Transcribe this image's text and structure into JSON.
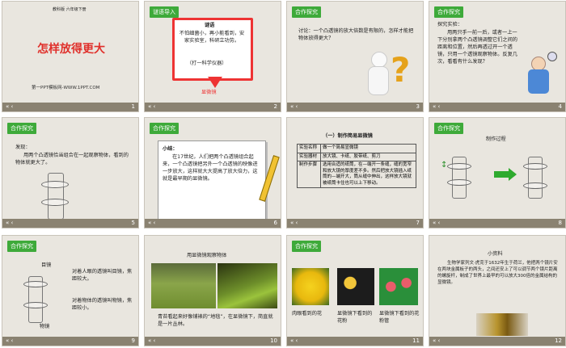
{
  "footer": {
    "nav_glyph": "«  ‹"
  },
  "slides": {
    "s1": {
      "publisher": "教科版   六年级下册",
      "title": "怎样放得更大",
      "site": "第一PPT模板网-WWW.1PPT.COM",
      "num": "1"
    },
    "s2": {
      "tag": "谜语导入",
      "riddle_title": "谜语",
      "riddle": "不怕细菌小，再小能看到，安家实验室，科研立功劳。",
      "hint": "（打一科学仪器）",
      "answer": "显微镜",
      "num": "2"
    },
    "s3": {
      "tag": "合作探究",
      "text": "讨论：一个凸透镜的放大倍数是有限的，怎样才能把物体放得更大？",
      "num": "3"
    },
    "s4": {
      "tag": "合作探究",
      "heading": "探究实验：",
      "text": "用两只手一前一后，或者一上一下分别拿两个凸透镜调整它们之间的距离和位置，然后再透过开一个透镜，只用一个透镜观察物体。反复几次，看看有什么发现？",
      "num": "4"
    },
    "s5": {
      "tag": "合作探究",
      "heading": "发现：",
      "text": "用两个凸透镜恰当组合在一起观察物体，看到的物体就更大了。",
      "num": "5"
    },
    "s6": {
      "tag": "合作探究",
      "heading": "小结：",
      "text": "在17世纪，人们把两个凸透镜组合起来，一个凸透镜把另外一个凸透镜的映像进一步放大，这样就大大提高了放大倍力，这就是最早期的显微镜。",
      "num": "6"
    },
    "s7": {
      "title": "（一）制作简易显微镜",
      "rows": [
        {
          "label": "实验名称",
          "value": "做一个简易显微镜"
        },
        {
          "label": "实验器材",
          "value": "放大镜、卡纸、胶带纸、剪刀"
        },
        {
          "label": "制作步骤",
          "value": "选用合适的纸筒，在—端开一条缝，缝的宽窄和放大镜的厚度差不多。然后把放大镜插入纸筒的—端开大，筒从缝中伸出，这样放大镜就被纸筒卡住也可以上下移动。"
        }
      ],
      "num": "7"
    },
    "s8": {
      "tag": "合作探究",
      "heading": "制作过程",
      "num": "8"
    },
    "s9": {
      "tag": "合作探究",
      "eyepiece": "目镜",
      "objective": "物镜",
      "text1": "对着人眼的透镜叫目镜，焦距较大。",
      "text2": "对着物体的透镜叫物镜，焦距较小。",
      "num": "9"
    },
    "s10": {
      "title": "用显微镜观察物体",
      "caption": "青苔看起来好像铺裱的“地毯”，在显微镜下，简直就是一片丛林。",
      "num": "10"
    },
    "s11": {
      "tag": "合作探究",
      "cap1": "肉眼看到的花",
      "cap2": "显微镜下看到的花粉",
      "cap3": "显微镜下看到的花粉管",
      "num": "11"
    },
    "s12": {
      "title": "小资料",
      "text": "生物学家列文·虎克于1632年生于荷兰，他把两个镜片安在两块金属板子的两头，之间还安上了可以调节两个镜片距离的螺旋杆，制成了世界上最早的可以放大300倍的金属结构的显微镜。",
      "num": "12"
    }
  }
}
